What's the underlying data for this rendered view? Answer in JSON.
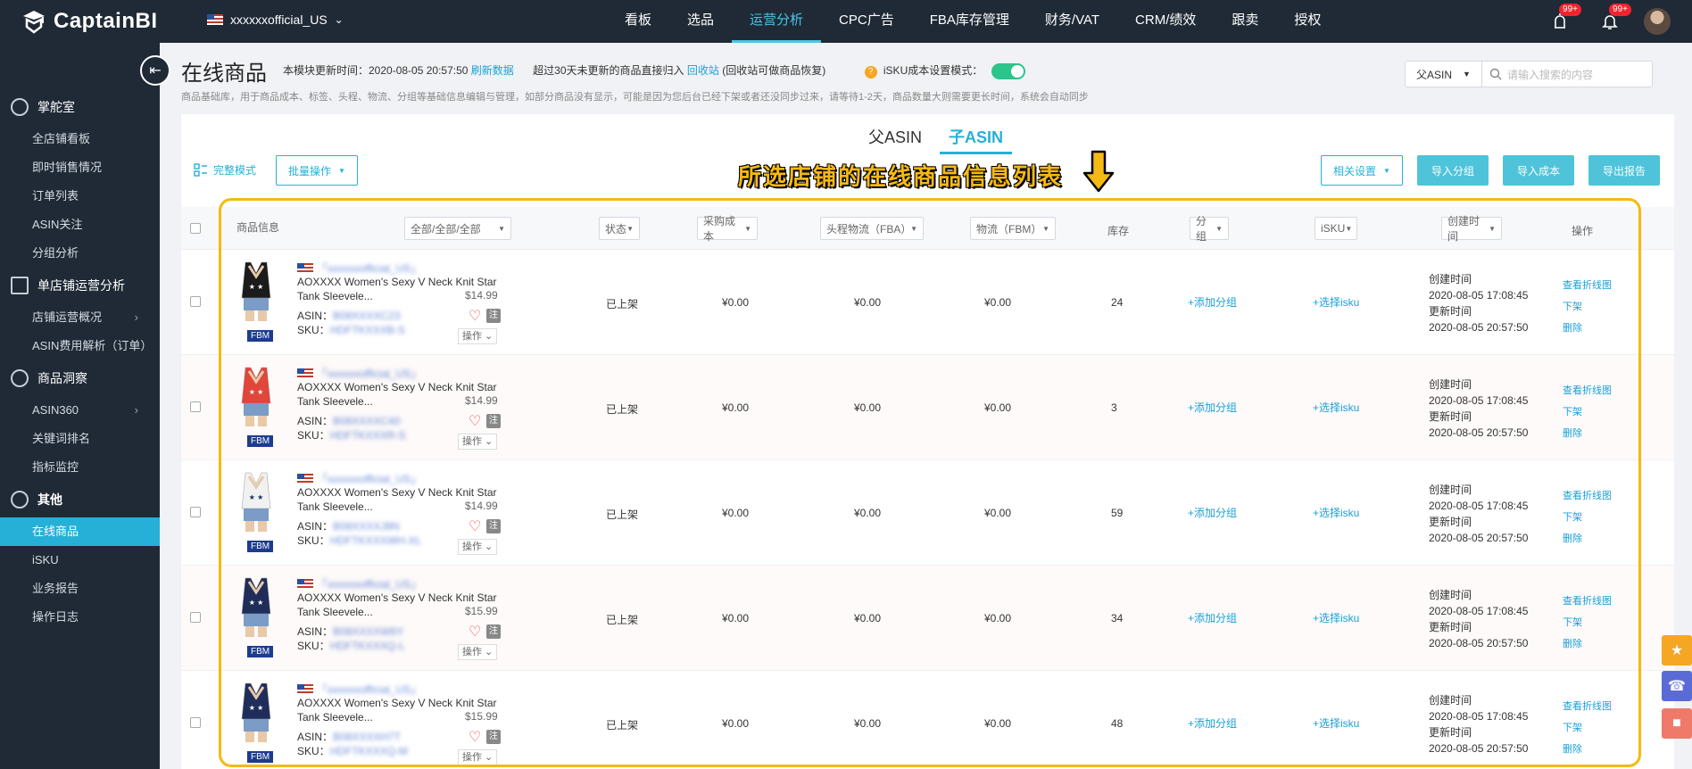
{
  "app": {
    "logo_text": "CaptainBI",
    "store_name": "xxxxxxofficial_US"
  },
  "nav": {
    "items": [
      "看板",
      "选品",
      "运营分析",
      "CPC广告",
      "FBA库存管理",
      "财务/VAT",
      "CRM/绩效",
      "跟卖",
      "授权"
    ],
    "active": "运营分析",
    "badge1": "99+",
    "badge2": "99+"
  },
  "sidebar": {
    "sections": [
      {
        "title": "掌舵室",
        "icon": "helm-icon",
        "items": [
          "全店铺看板",
          "即时销售情况",
          "订单列表",
          "ASIN关注",
          "分组分析"
        ]
      },
      {
        "title": "单店铺运营分析",
        "icon": "bar-chart-icon",
        "items": [
          "店铺运营概况",
          "ASIN费用解析（订单）"
        ]
      },
      {
        "title": "商品洞察",
        "icon": "pie-chart-icon",
        "items": [
          "ASIN360",
          "关键词排名",
          "指标监控"
        ]
      },
      {
        "title": "其他",
        "icon": "more-icon",
        "items": [
          "在线商品",
          "iSKU",
          "业务报告",
          "操作日志"
        ]
      }
    ],
    "active_item": "在线商品"
  },
  "page": {
    "title": "在线商品",
    "update_label": "本模块更新时间：2020-08-05 20:57:50",
    "refresh_link": "刷新数据",
    "recycle_text": "超过30天未更新的商品直接归入",
    "recycle_link": "回收站",
    "recycle_note": "(回收站可做商品恢复)",
    "isku_label": "iSKU成本设置模式：",
    "description": "商品基础库，用于商品成本、标签、头程、物流、分组等基础信息编辑与管理，如部分商品没有显示，可能是因为您后台已经下架或者还没同步过来，请等待1-2天，商品数量大则需要更长时间，系统会自动同步",
    "search_select": "父ASIN",
    "search_placeholder": "请输入搜索的内容"
  },
  "panel": {
    "tabs": [
      "父ASIN",
      "子ASIN"
    ],
    "active_tab": "子ASIN",
    "mode_label": "完整模式",
    "batch_button": "批量操作",
    "related_button": "相关设置",
    "import_group": "导入分组",
    "import_cost": "导入成本",
    "export_report": "导出报告",
    "annotation": "所选店铺的在线商品信息列表"
  },
  "table": {
    "headers": {
      "product": "商品信息",
      "filter": "全部/全部/全部",
      "status": "状态",
      "purchase_cost": "采购成本",
      "fba_shipping": "头程物流（FBA）",
      "fbm_shipping": "物流（FBM）",
      "stock": "库存",
      "group": "分组",
      "isku": "iSKU",
      "created": "创建时间",
      "ops": "操作"
    },
    "rows": [
      {
        "store": "「xxxxxxofficial_US」",
        "title": "AOXXXX Women's Sexy V Neck Knit Star Tank Sleevele...",
        "price": "$14.99",
        "asin": "B08XXXXC23",
        "sku": "HDFTKXXXB-S",
        "status": "已上架",
        "cost": "¥0.00",
        "fba": "¥0.00",
        "fbm": "¥0.00",
        "stock": "24",
        "group": "+添加分组",
        "isku": "+选择isku",
        "created_label": "创建时间",
        "created": "2020-08-05 17:08:45",
        "updated_label": "更新时间",
        "updated": "2020-08-05 20:57:50",
        "act1": "查看折线图",
        "act2": "下架",
        "act3": "删除",
        "fbm_tag": "FBM",
        "op": "操作",
        "note": "注",
        "img_color": "#1b1b1b"
      },
      {
        "store": "「xxxxxxofficial_US」",
        "title": "AOXXXX Women's Sexy V Neck Knit Star Tank Sleevele...",
        "price": "$14.99",
        "asin": "B08XXXXC40",
        "sku": "HDFTKXXXR-S",
        "status": "已上架",
        "cost": "¥0.00",
        "fba": "¥0.00",
        "fbm": "¥0.00",
        "stock": "3",
        "group": "+添加分组",
        "isku": "+选择isku",
        "created_label": "创建时间",
        "created": "2020-08-05 17:08:45",
        "updated_label": "更新时间",
        "updated": "2020-08-05 20:57:50",
        "act1": "查看折线图",
        "act2": "下架",
        "act3": "删除",
        "fbm_tag": "FBM",
        "op": "操作",
        "note": "注",
        "img_color": "#e0463a"
      },
      {
        "store": "「xxxxxxofficial_US」",
        "title": "AOXXXX Women's Sexy V Neck Knit Star Tank Sleevele...",
        "price": "$14.99",
        "asin": "B08XXXXJ8N",
        "sku": "HDFTKXXXWH-XL",
        "status": "已上架",
        "cost": "¥0.00",
        "fba": "¥0.00",
        "fbm": "¥0.00",
        "stock": "59",
        "group": "+添加分组",
        "isku": "+选择isku",
        "created_label": "创建时间",
        "created": "2020-08-05 17:08:45",
        "updated_label": "更新时间",
        "updated": "2020-08-05 20:57:50",
        "act1": "查看折线图",
        "act2": "下架",
        "act3": "删除",
        "fbm_tag": "FBM",
        "op": "操作",
        "note": "注",
        "img_color": "#f1f1f1"
      },
      {
        "store": "「xxxxxxofficial_US」",
        "title": "AOXXXX Women's Sexy V Neck Knit Star Tank Sleevele...",
        "price": "$15.99",
        "asin": "B08XXXXW6Y",
        "sku": "HDFTKXXXQ-L",
        "status": "已上架",
        "cost": "¥0.00",
        "fba": "¥0.00",
        "fbm": "¥0.00",
        "stock": "34",
        "group": "+添加分组",
        "isku": "+选择isku",
        "created_label": "创建时间",
        "created": "2020-08-05 17:08:45",
        "updated_label": "更新时间",
        "updated": "2020-08-05 20:57:50",
        "act1": "查看折线图",
        "act2": "下架",
        "act3": "删除",
        "fbm_tag": "FBM",
        "op": "操作",
        "note": "注",
        "img_color": "#1f2d5a"
      },
      {
        "store": "「xxxxxxofficial_US」",
        "title": "AOXXXX Women's Sexy V Neck Knit Star Tank Sleevele...",
        "price": "$15.99",
        "asin": "B08XXXXH7T",
        "sku": "HDFTKXXXQ-M",
        "status": "已上架",
        "cost": "¥0.00",
        "fba": "¥0.00",
        "fbm": "¥0.00",
        "stock": "48",
        "group": "+添加分组",
        "isku": "+选择isku",
        "created_label": "创建时间",
        "created": "2020-08-05 17:08:45",
        "updated_label": "更新时间",
        "updated": "2020-08-05 20:57:50",
        "act1": "查看折线图",
        "act2": "下架",
        "act3": "删除",
        "fbm_tag": "FBM",
        "op": "操作",
        "note": "注",
        "img_color": "#1f2d5a"
      }
    ]
  },
  "colors": {
    "accent": "#26b0d7",
    "annotation": "#f5b914",
    "sidebar_bg": "#1f2a36"
  }
}
